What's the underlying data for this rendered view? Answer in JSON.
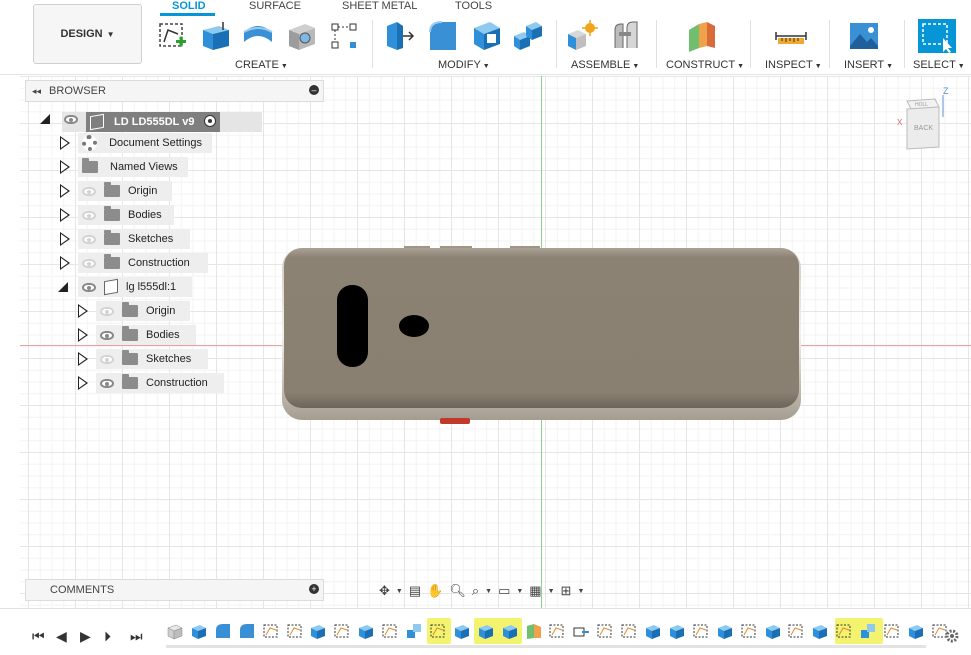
{
  "workspace": {
    "label": "DESIGN"
  },
  "tabs": [
    {
      "label": "SOLID",
      "active": true
    },
    {
      "label": "SURFACE",
      "active": false
    },
    {
      "label": "SHEET METAL",
      "active": false
    },
    {
      "label": "TOOLS",
      "active": false
    }
  ],
  "toolbar_groups": {
    "create": "CREATE",
    "modify": "MODIFY",
    "assemble": "ASSEMBLE",
    "construct": "CONSTRUCT",
    "inspect": "INSPECT",
    "insert": "INSERT",
    "select": "SELECT"
  },
  "browser": {
    "title": "BROWSER",
    "root": "LD LD555DL v9",
    "items": [
      {
        "label": "Document Settings",
        "icon": "gear-icon"
      },
      {
        "label": "Named Views",
        "icon": "folder-icon"
      },
      {
        "label": "Origin",
        "icon": "folder-icon",
        "visible": false
      },
      {
        "label": "Bodies",
        "icon": "folder-icon",
        "visible": false
      },
      {
        "label": "Sketches",
        "icon": "folder-icon",
        "visible": false
      },
      {
        "label": "Construction",
        "icon": "folder-icon",
        "visible": false
      },
      {
        "label": "lg l555dl:1",
        "icon": "component-icon",
        "visible": true
      }
    ],
    "sub_items": [
      {
        "label": "Origin",
        "visible": false
      },
      {
        "label": "Bodies",
        "visible": true
      },
      {
        "label": "Sketches",
        "visible": false
      },
      {
        "label": "Construction",
        "visible": true
      }
    ]
  },
  "viewcube": {
    "face": "BACK",
    "top_face": "HOLL",
    "axis_z": "Z",
    "axis_x": "X"
  },
  "comments": {
    "title": "COMMENTS"
  },
  "colors": {
    "accent": "#0696d7",
    "axis_x": "#e9a0a0",
    "axis_y": "#8fd18f",
    "highlight": "#f3f370",
    "body": "#8a8072"
  }
}
